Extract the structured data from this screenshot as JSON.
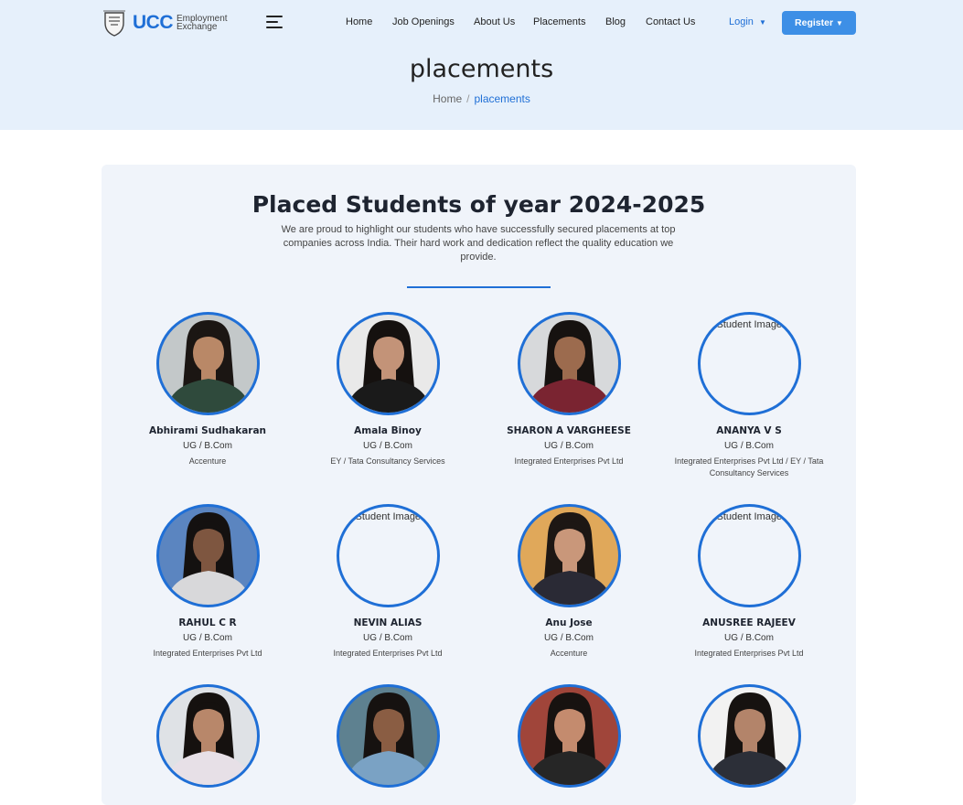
{
  "brand": {
    "name": "UCC",
    "tagline_line1": "Employment",
    "tagline_line2": "Exchange"
  },
  "nav": {
    "items": [
      "Home",
      "Job Openings",
      "About Us",
      "Placements",
      "Blog",
      "Contact Us"
    ],
    "login_label": "Login",
    "register_label": "Register",
    "caret": "▼"
  },
  "hero": {
    "title": "placements",
    "breadcrumb_home": "Home",
    "breadcrumb_sep": "/",
    "breadcrumb_current": "placements"
  },
  "section": {
    "title": "Placed Students of year 2024-2025",
    "description": "We are proud to highlight our students who have successfully secured placements at top companies across India. Their hard work and dedication reflect the quality education we provide."
  },
  "students": [
    {
      "name": "Abhirami Sudhakaran",
      "course": "UG / B.Com",
      "company": "Accenture",
      "photo": "photo",
      "skin": "#b98867",
      "hair": "#1b1613",
      "shirt": "#2f4a3c",
      "bg": "#c3c8c9"
    },
    {
      "name": "Amala Binoy",
      "course": "UG / B.Com",
      "company": "EY / Tata Consultancy Services",
      "photo": "photo",
      "skin": "#c39378",
      "hair": "#15110f",
      "shirt": "#1a1a1a",
      "bg": "#e9e9e9"
    },
    {
      "name": "SHARON A VARGHEESE",
      "course": "UG / B.Com",
      "company": "Integrated Enterprises Pvt Ltd",
      "photo": "photo",
      "skin": "#9c6b4e",
      "hair": "#161210",
      "shirt": "#7a2431",
      "bg": "#d7d9db"
    },
    {
      "name": "ANANYA V S",
      "course": "UG / B.Com",
      "company": "Integrated Enterprises Pvt Ltd / EY / Tata Consultancy Services",
      "photo": "missing",
      "alt": "Student Image"
    },
    {
      "name": "RAHUL C R",
      "course": "UG / B.Com",
      "company": "Integrated Enterprises Pvt Ltd",
      "photo": "photo",
      "skin": "#7e5640",
      "hair": "#141110",
      "shirt": "#d8d8da",
      "bg": "#5b85c0"
    },
    {
      "name": "NEVIN ALIAS",
      "course": "UG / B.Com",
      "company": "Integrated Enterprises Pvt Ltd",
      "photo": "missing",
      "alt": "Student Image"
    },
    {
      "name": "Anu Jose",
      "course": "UG / B.Com",
      "company": "Accenture",
      "photo": "photo",
      "skin": "#c9977a",
      "hair": "#1d1714",
      "shirt": "#2a2a35",
      "bg": "#e0a85a"
    },
    {
      "name": "ANUSREE RAJEEV",
      "course": "UG / B.Com",
      "company": "Integrated Enterprises Pvt Ltd",
      "photo": "missing",
      "alt": "Student Image"
    },
    {
      "name": "",
      "course": "",
      "company": "",
      "photo": "photo",
      "skin": "#b8876a",
      "hair": "#15110f",
      "shirt": "#e7e0e7",
      "bg": "#dfe2e6"
    },
    {
      "name": "",
      "course": "",
      "company": "",
      "photo": "photo",
      "skin": "#8a5d43",
      "hair": "#161210",
      "shirt": "#7aa2c4",
      "bg": "#5e8190"
    },
    {
      "name": "",
      "course": "",
      "company": "",
      "photo": "photo",
      "skin": "#c48b6e",
      "hair": "#171210",
      "shirt": "#262626",
      "bg": "#a0453a"
    },
    {
      "name": "",
      "course": "",
      "company": "",
      "photo": "photo",
      "skin": "#b3846a",
      "hair": "#161210",
      "shirt": "#2c2f38",
      "bg": "#f2f2f2"
    }
  ],
  "colors": {
    "accent": "#1f6fd6",
    "hero_bg": "#e6f0fb",
    "card_bg": "#f0f4fa",
    "register_bg": "#3d8fe6"
  },
  "icons": {
    "menu": "hamburger-icon",
    "logo": "university-emblem-icon"
  }
}
